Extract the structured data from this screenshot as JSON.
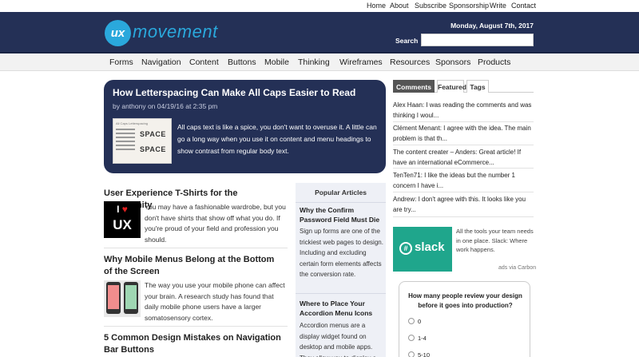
{
  "topnav": [
    "Home",
    "About",
    "Subscribe",
    "Sponsorship",
    "Write",
    "Contact"
  ],
  "header": {
    "logo_badge": "ux",
    "logo_text": "movement",
    "date": "Monday, August 7th, 2017",
    "search_label": "Search",
    "search_value": ""
  },
  "nav": [
    "Forms",
    "Navigation",
    "Content",
    "Buttons",
    "Mobile",
    "Thinking",
    "Wireframes",
    "Resources",
    "Sponsors",
    "Products"
  ],
  "featured": {
    "title": "How Letterspacing Can Make All Caps Easier to Read",
    "meta": "by anthony on 04/19/16 at 2:35 pm",
    "thumb_heading": "All Caps Letterspacing",
    "thumb_word": "SPACE",
    "excerpt": "All caps text is like a spice, you don't want to overuse it. A little can go a long way when you use it on content and menu headings to show contrast from regular body text."
  },
  "articles": [
    {
      "title": "User Experience T-Shirts for the Community",
      "excerpt": "You may have a fashionable wardrobe, but you don't have shirts that show off what you do. If you're proud of your field and profession you should."
    },
    {
      "title": "Why Mobile Menus Belong at the Bottom of the Screen",
      "excerpt": "The way you use your mobile phone can affect your brain. A research study has found that daily mobile phone users have a larger somatosensory cortex."
    },
    {
      "title": "5 Common Design Mistakes on Navigation Bar Buttons",
      "excerpt": ""
    }
  ],
  "tshirt_logo": {
    "line1_left": "I",
    "line1_heart": "♥",
    "line2": "UX"
  },
  "popular": {
    "heading": "Popular Articles",
    "items": [
      {
        "title": "Why the Confirm Password Field Must Die",
        "excerpt": "Sign up forms are one of the trickiest web pages to design. Including and excluding certain form elements affects the conversion rate."
      },
      {
        "title": "Where to Place Your Accordion Menu Icons",
        "excerpt": "Accordion menus are a display widget found on desktop and mobile apps. They allow you to display a"
      }
    ]
  },
  "sidebar": {
    "tabs": [
      "Comments",
      "Featured",
      "Tags"
    ],
    "active_tab": "Comments",
    "comments": [
      "Alex Haan: I was reading the comments and was thinking I woul...",
      "Clément Menant: I agree with the idea. The main problem is that th...",
      "The content creater – Anders: Great article! If have an international eCommerce...",
      "TenTen71: I like the ideas but the number 1 concern I have i...",
      "Andrew: I don't agree with this. It looks like you are try..."
    ]
  },
  "ad": {
    "brand": "slack",
    "text": "All the tools your team needs in one place. Slack: Where work happens.",
    "via": "ads via Carbon"
  },
  "poll": {
    "question": "How many people review your design before it goes into production?",
    "options": [
      "0",
      "1-4",
      "5-10"
    ]
  },
  "colors": {
    "header_bg": "#243056",
    "accent": "#2aa8dc",
    "slack_green": "#1fa68c",
    "popular_bg": "#eef0f6"
  }
}
